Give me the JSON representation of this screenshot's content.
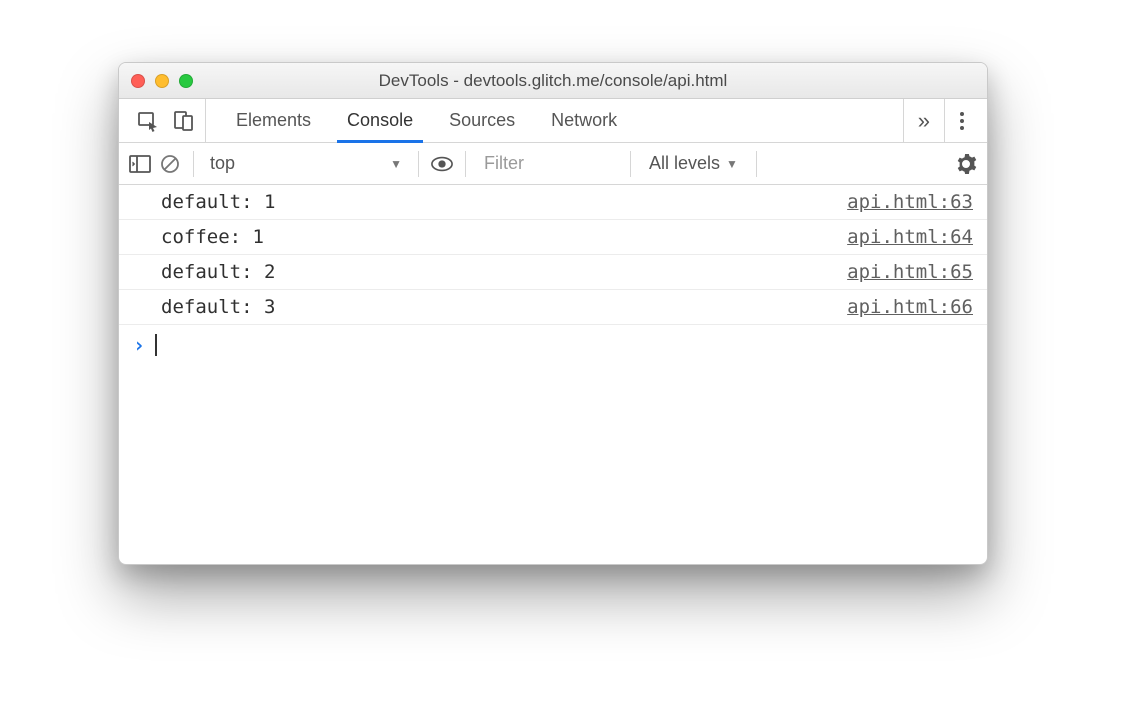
{
  "window": {
    "title": "DevTools - devtools.glitch.me/console/api.html"
  },
  "tabs": {
    "items": [
      "Elements",
      "Console",
      "Sources",
      "Network"
    ],
    "active_index": 1,
    "overflow_glyph": "»"
  },
  "filterbar": {
    "context": "top",
    "filter_placeholder": "Filter",
    "levels_label": "All levels"
  },
  "console": {
    "rows": [
      {
        "text": "default: 1",
        "source": "api.html:63"
      },
      {
        "text": "coffee: 1",
        "source": "api.html:64"
      },
      {
        "text": "default: 2",
        "source": "api.html:65"
      },
      {
        "text": "default: 3",
        "source": "api.html:66"
      }
    ]
  }
}
